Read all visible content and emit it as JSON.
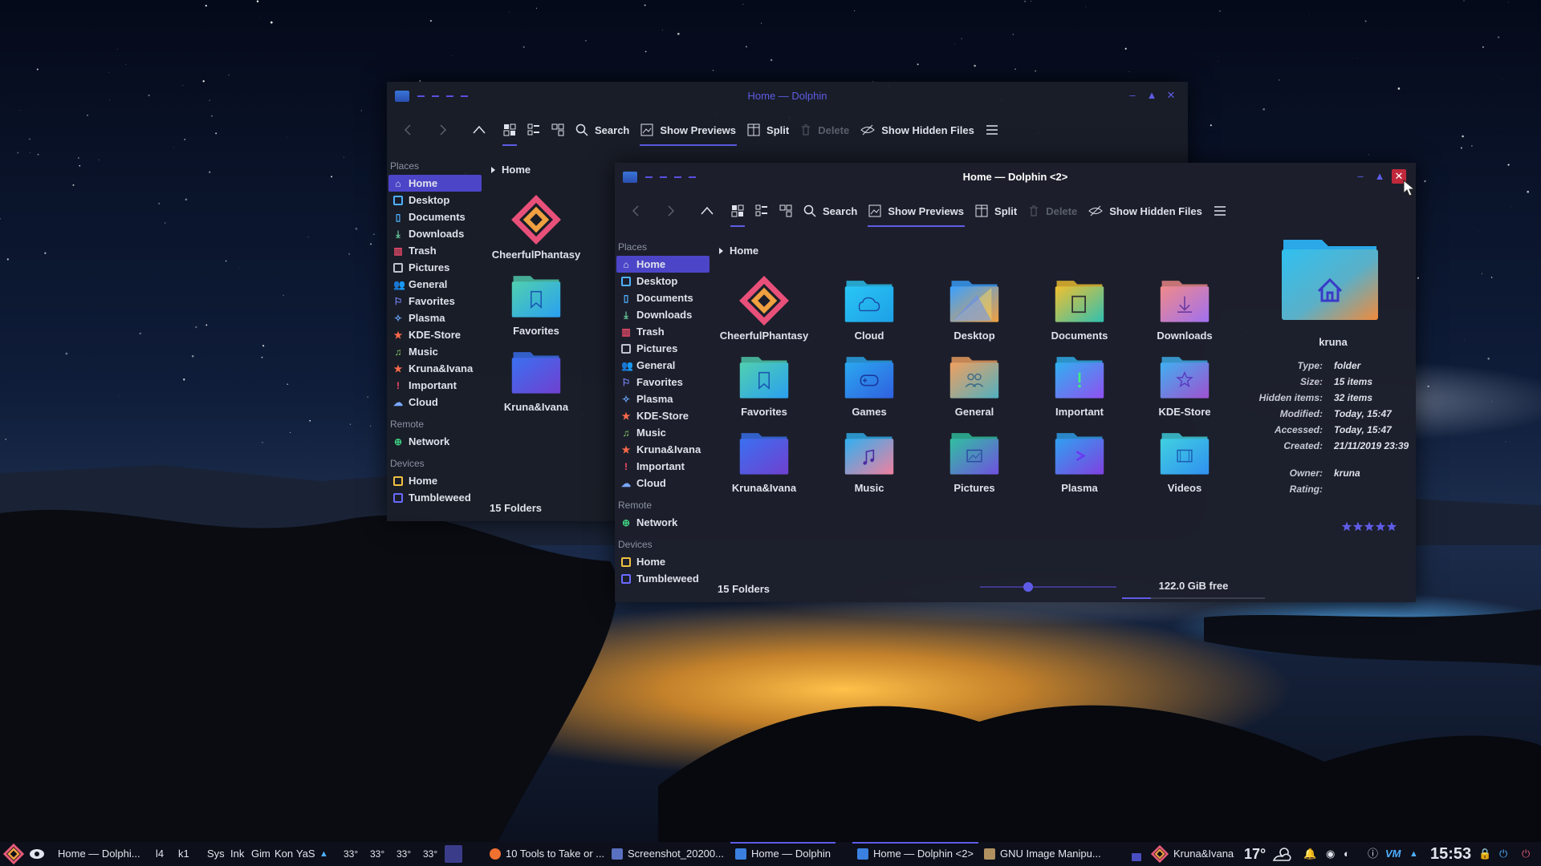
{
  "wallpaper": {
    "sky": "#0a1226",
    "city_glow": "#f0a030",
    "fog": "#c9d0dc"
  },
  "colors": {
    "accent": "#5e5ce6",
    "window_bg": "#1a1e28",
    "text": "#dfe2ea",
    "selection": "#4d45c8"
  },
  "back_window": {
    "title": "Home — Dolphin",
    "toolbar": {
      "search": "Search",
      "previews": "Show Previews",
      "split": "Split",
      "delete": "Delete",
      "hidden": "Show Hidden Files"
    },
    "places_title": "Places",
    "places": [
      "Home",
      "Desktop",
      "Documents",
      "Downloads",
      "Trash",
      "Pictures",
      "General",
      "Favorites",
      "Plasma",
      "KDE-Store",
      "Music",
      "Kruna&Ivana",
      "Important",
      "Cloud"
    ],
    "remote_title": "Remote",
    "remote": [
      "Network"
    ],
    "devices_title": "Devices",
    "devices": [
      "Home",
      "Tumbleweed"
    ],
    "breadcrumb": "Home",
    "items": [
      "CheerfulPhantasy",
      "Favorites",
      "Kruna&Ivana"
    ],
    "status": "15 Folders"
  },
  "front_window": {
    "title": "Home — Dolphin <2>",
    "toolbar": {
      "search": "Search",
      "previews": "Show Previews",
      "split": "Split",
      "delete": "Delete",
      "hidden": "Show Hidden Files"
    },
    "places_title": "Places",
    "places": [
      "Home",
      "Desktop",
      "Documents",
      "Downloads",
      "Trash",
      "Pictures",
      "General",
      "Favorites",
      "Plasma",
      "KDE-Store",
      "Music",
      "Kruna&Ivana",
      "Important",
      "Cloud"
    ],
    "remote_title": "Remote",
    "remote": [
      "Network"
    ],
    "devices_title": "Devices",
    "devices": [
      "Home",
      "Tumbleweed"
    ],
    "breadcrumb": "Home",
    "items": [
      {
        "name": "CheerfulPhantasy",
        "icon": "logo-icon"
      },
      {
        "name": "Cloud",
        "icon": "cloud-icon"
      },
      {
        "name": "Desktop",
        "icon": "desktop-icon"
      },
      {
        "name": "Documents",
        "icon": "document-icon"
      },
      {
        "name": "Downloads",
        "icon": "download-icon"
      },
      {
        "name": "Favorites",
        "icon": "bookmark-icon"
      },
      {
        "name": "Games",
        "icon": "gamepad-icon"
      },
      {
        "name": "General",
        "icon": "people-icon"
      },
      {
        "name": "Important",
        "icon": "exclamation-icon"
      },
      {
        "name": "KDE-Store",
        "icon": "star-icon"
      },
      {
        "name": "Kruna&Ivana",
        "icon": "folder-icon"
      },
      {
        "name": "Music",
        "icon": "music-icon"
      },
      {
        "name": "Pictures",
        "icon": "image-icon"
      },
      {
        "name": "Plasma",
        "icon": "plasma-icon"
      },
      {
        "name": "Videos",
        "icon": "video-icon"
      }
    ],
    "status": "15 Folders",
    "zoom_level": 0.35,
    "free_space": "122.0 GiB free",
    "free_space_used_fraction": 0.2,
    "info": {
      "name": "kruna",
      "rows": [
        {
          "label": "Type:",
          "value": "folder"
        },
        {
          "label": "Size:",
          "value": "15 items"
        },
        {
          "label": "Hidden items:",
          "value": "32 items"
        },
        {
          "label": "Modified:",
          "value": "Today, 15:47"
        },
        {
          "label": "Accessed:",
          "value": "Today, 15:47"
        },
        {
          "label": "Created:",
          "value": "21/11/2019 23:39"
        },
        {
          "label": "Owner:",
          "value": "kruna"
        },
        {
          "label": "Rating:",
          "value": ""
        }
      ],
      "rating_stars": 5
    }
  },
  "taskbar": {
    "left_task": "Home — Dolphi...",
    "pager": [
      "l4",
      "k1"
    ],
    "quick": [
      "Sys",
      "Ink",
      "Gim",
      "Kon",
      "YaS"
    ],
    "temps": [
      "33°",
      "33°",
      "33°",
      "33°"
    ],
    "tasks": [
      {
        "label": "10 Tools to Take or ...",
        "icon": "firefox-icon"
      },
      {
        "label": "Screenshot_20200...",
        "icon": "image-viewer-icon"
      },
      {
        "label": "Home — Dolphin",
        "icon": "dolphin-icon"
      },
      {
        "label": "Home — Dolphin <2>",
        "icon": "dolphin-icon"
      },
      {
        "label": "GNU Image Manipu...",
        "icon": "gimp-icon"
      }
    ],
    "user": "Kruna&Ivana",
    "weather_temp": "17°",
    "clock": "15:53"
  }
}
